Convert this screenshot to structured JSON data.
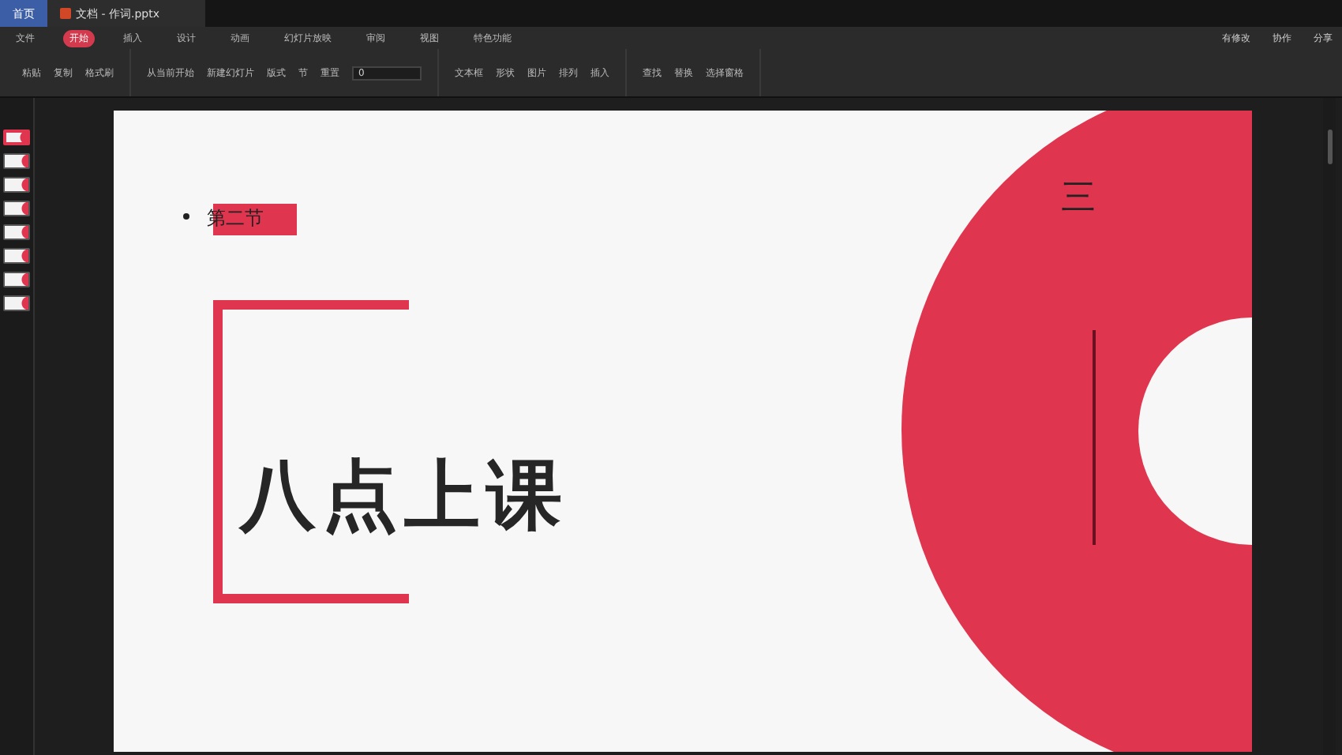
{
  "tabs": [
    {
      "label": "首页",
      "kind": "home",
      "selected": false
    },
    {
      "label": "文档 - 作词.pptx",
      "kind": "doc",
      "selected": true
    }
  ],
  "menu": [
    {
      "label": "文件",
      "selected": false
    },
    {
      "label": "开始",
      "selected": true
    },
    {
      "label": "插入",
      "selected": false
    },
    {
      "label": "设计",
      "selected": false
    },
    {
      "label": "动画",
      "selected": false
    },
    {
      "label": "幻灯片放映",
      "selected": false
    },
    {
      "label": "审阅",
      "selected": false
    },
    {
      "label": "视图",
      "selected": false
    },
    {
      "label": "特色功能",
      "selected": false
    }
  ],
  "top_actions": [
    "有修改",
    "协作",
    "分享"
  ],
  "toolbar": {
    "groups": [
      {
        "items": [
          "粘贴",
          "复制",
          "格式刷"
        ]
      },
      {
        "items": [
          "从当前开始",
          "新建幻灯片",
          "版式",
          "节",
          "重置"
        ]
      },
      {
        "items": [
          "文本框",
          "形状",
          "图片",
          "排列",
          "插入"
        ]
      },
      {
        "items": [
          "查找",
          "替换",
          "选择窗格"
        ]
      }
    ],
    "font_size": "0"
  },
  "thumbnails": [
    {
      "selected": true
    },
    {
      "selected": false
    },
    {
      "selected": false
    },
    {
      "selected": false
    },
    {
      "selected": false
    },
    {
      "selected": false
    },
    {
      "selected": false
    },
    {
      "selected": false
    }
  ],
  "slide": {
    "bullet": "第二节",
    "number": "三",
    "title": "八点上课"
  }
}
